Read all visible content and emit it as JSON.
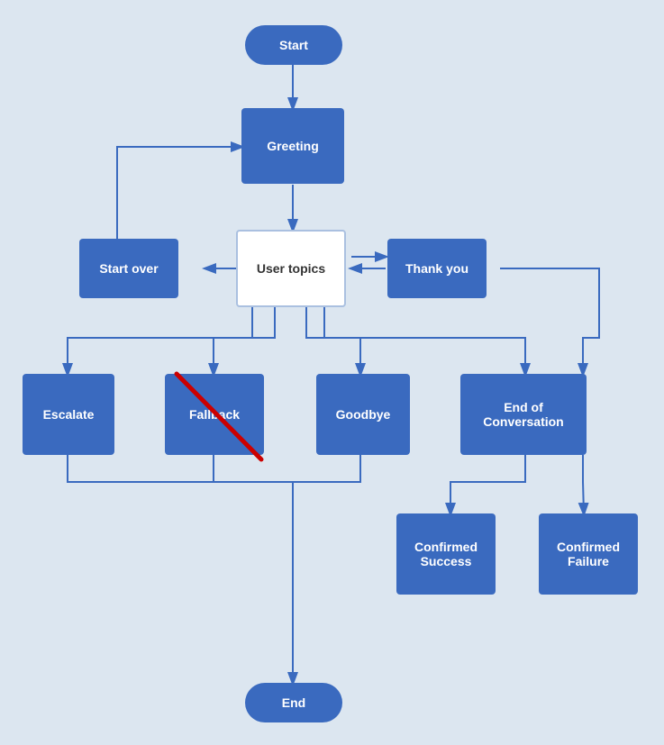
{
  "nodes": {
    "start": {
      "label": "Start"
    },
    "greeting": {
      "label": "Greeting"
    },
    "user_topics": {
      "label": "User topics"
    },
    "start_over": {
      "label": "Start over"
    },
    "thank_you": {
      "label": "Thank you"
    },
    "escalate": {
      "label": "Escalate"
    },
    "fallback": {
      "label": "Fallback"
    },
    "goodbye": {
      "label": "Goodbye"
    },
    "end_of_conversation": {
      "label": "End of\nConversation"
    },
    "confirmed_success": {
      "label": "Confirmed\nSuccess"
    },
    "confirmed_failure": {
      "label": "Confirmed\nFailure"
    },
    "end": {
      "label": "End"
    }
  },
  "colors": {
    "node_bg": "#3a6abf",
    "node_outline": "#aac0e0",
    "arrow": "#3a6abf",
    "background": "#dce6f0",
    "red": "#cc0000"
  }
}
